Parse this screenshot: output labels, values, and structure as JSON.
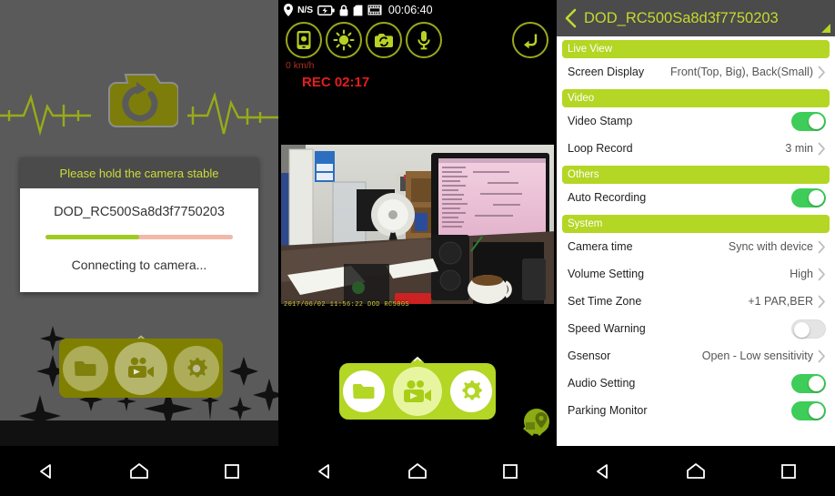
{
  "panel1": {
    "name": "connecting-screen",
    "logo_icon": "camera-refresh-logo",
    "dialog": {
      "title": "Please hold the camera stable",
      "device_name": "DOD_RC500Sa8d3f7750203",
      "progress_percent": 50,
      "status": "Connecting to camera...",
      "track_color": "#f2b8a8",
      "fill_color": "#9ccc1f"
    },
    "dock": {
      "items": [
        {
          "icon": "folder-icon",
          "name": "files"
        },
        {
          "icon": "video-camera-icon",
          "name": "live-view"
        },
        {
          "icon": "gear-icon",
          "name": "settings"
        }
      ],
      "color": "#808000"
    },
    "navbar": [
      {
        "icon": "back-triangle-icon",
        "name": "android-back"
      },
      {
        "icon": "home-icon",
        "name": "android-home"
      },
      {
        "icon": "recents-square-icon",
        "name": "android-recents"
      }
    ]
  },
  "panel2": {
    "name": "live-view-screen",
    "statusbar": {
      "gps_icon": "location-pin-icon",
      "gps_label": "N/S",
      "battery_icon": "battery-charging-icon",
      "lock_icon": "lock-icon",
      "sd_icon": "sd-card-icon",
      "film_icon": "film-strip-icon",
      "time": "00:06:40"
    },
    "toolbar": [
      {
        "icon": "phone-snapshot-icon",
        "name": "snapshot-to-phone"
      },
      {
        "icon": "brightness-sun-icon",
        "name": "brightness"
      },
      {
        "icon": "camera-switch-icon",
        "name": "switch-camera"
      },
      {
        "icon": "microphone-icon",
        "name": "microphone"
      }
    ],
    "back_button": {
      "icon": "return-arrow-icon",
      "name": "back"
    },
    "speed": "0 km/h",
    "rec": "REC 02:17",
    "video_stamp": "2017/06/02 11:56:22 DOD RC500S",
    "dock": {
      "items": [
        {
          "icon": "folder-icon",
          "name": "files"
        },
        {
          "icon": "video-camera-icon",
          "name": "live-view"
        },
        {
          "icon": "gear-icon",
          "name": "settings"
        }
      ],
      "color": "#b4d624",
      "arrow_icon": "chevron-up-icon"
    },
    "gps_badge_icon": "gps-map-pin-icon",
    "navbar": [
      {
        "icon": "back-triangle-icon",
        "name": "android-back"
      },
      {
        "icon": "home-icon",
        "name": "android-home"
      },
      {
        "icon": "recents-square-icon",
        "name": "android-recents"
      }
    ]
  },
  "panel3": {
    "name": "settings-screen",
    "titlebar": {
      "back_icon": "chevron-left-icon",
      "title": "DOD_RC500Sa8d3f7750203",
      "corner_icon": "resize-handle-icon"
    },
    "accent_green": "#b4d624",
    "toggle_on_color": "#3dcd58",
    "sections": [
      {
        "header": "Live View",
        "rows": [
          {
            "label": "Screen Display",
            "type": "value",
            "value": "Front(Top, Big), Back(Small)"
          }
        ]
      },
      {
        "header": "Video",
        "rows": [
          {
            "label": "Video Stamp",
            "type": "toggle",
            "state": "on"
          },
          {
            "label": "Loop Record",
            "type": "value",
            "value": "3 min"
          }
        ]
      },
      {
        "header": "Others",
        "rows": [
          {
            "label": "Auto Recording",
            "type": "toggle",
            "state": "on"
          }
        ]
      },
      {
        "header": "System",
        "rows": [
          {
            "label": "Camera time",
            "type": "value",
            "value": "Sync with device"
          },
          {
            "label": "Volume Setting",
            "type": "value",
            "value": "High"
          },
          {
            "label": "Set Time Zone",
            "type": "value",
            "value": "+1 PAR,BER"
          },
          {
            "label": "Speed Warning",
            "type": "toggle",
            "state": "off"
          },
          {
            "label": "Gsensor",
            "type": "value",
            "value": "Open - Low sensitivity"
          },
          {
            "label": "Audio Setting",
            "type": "toggle",
            "state": "on"
          },
          {
            "label": "Parking Monitor",
            "type": "toggle",
            "state": "on"
          }
        ]
      }
    ],
    "navbar": [
      {
        "icon": "back-triangle-icon",
        "name": "android-back"
      },
      {
        "icon": "home-icon",
        "name": "android-home"
      },
      {
        "icon": "recents-square-icon",
        "name": "android-recents"
      }
    ]
  }
}
